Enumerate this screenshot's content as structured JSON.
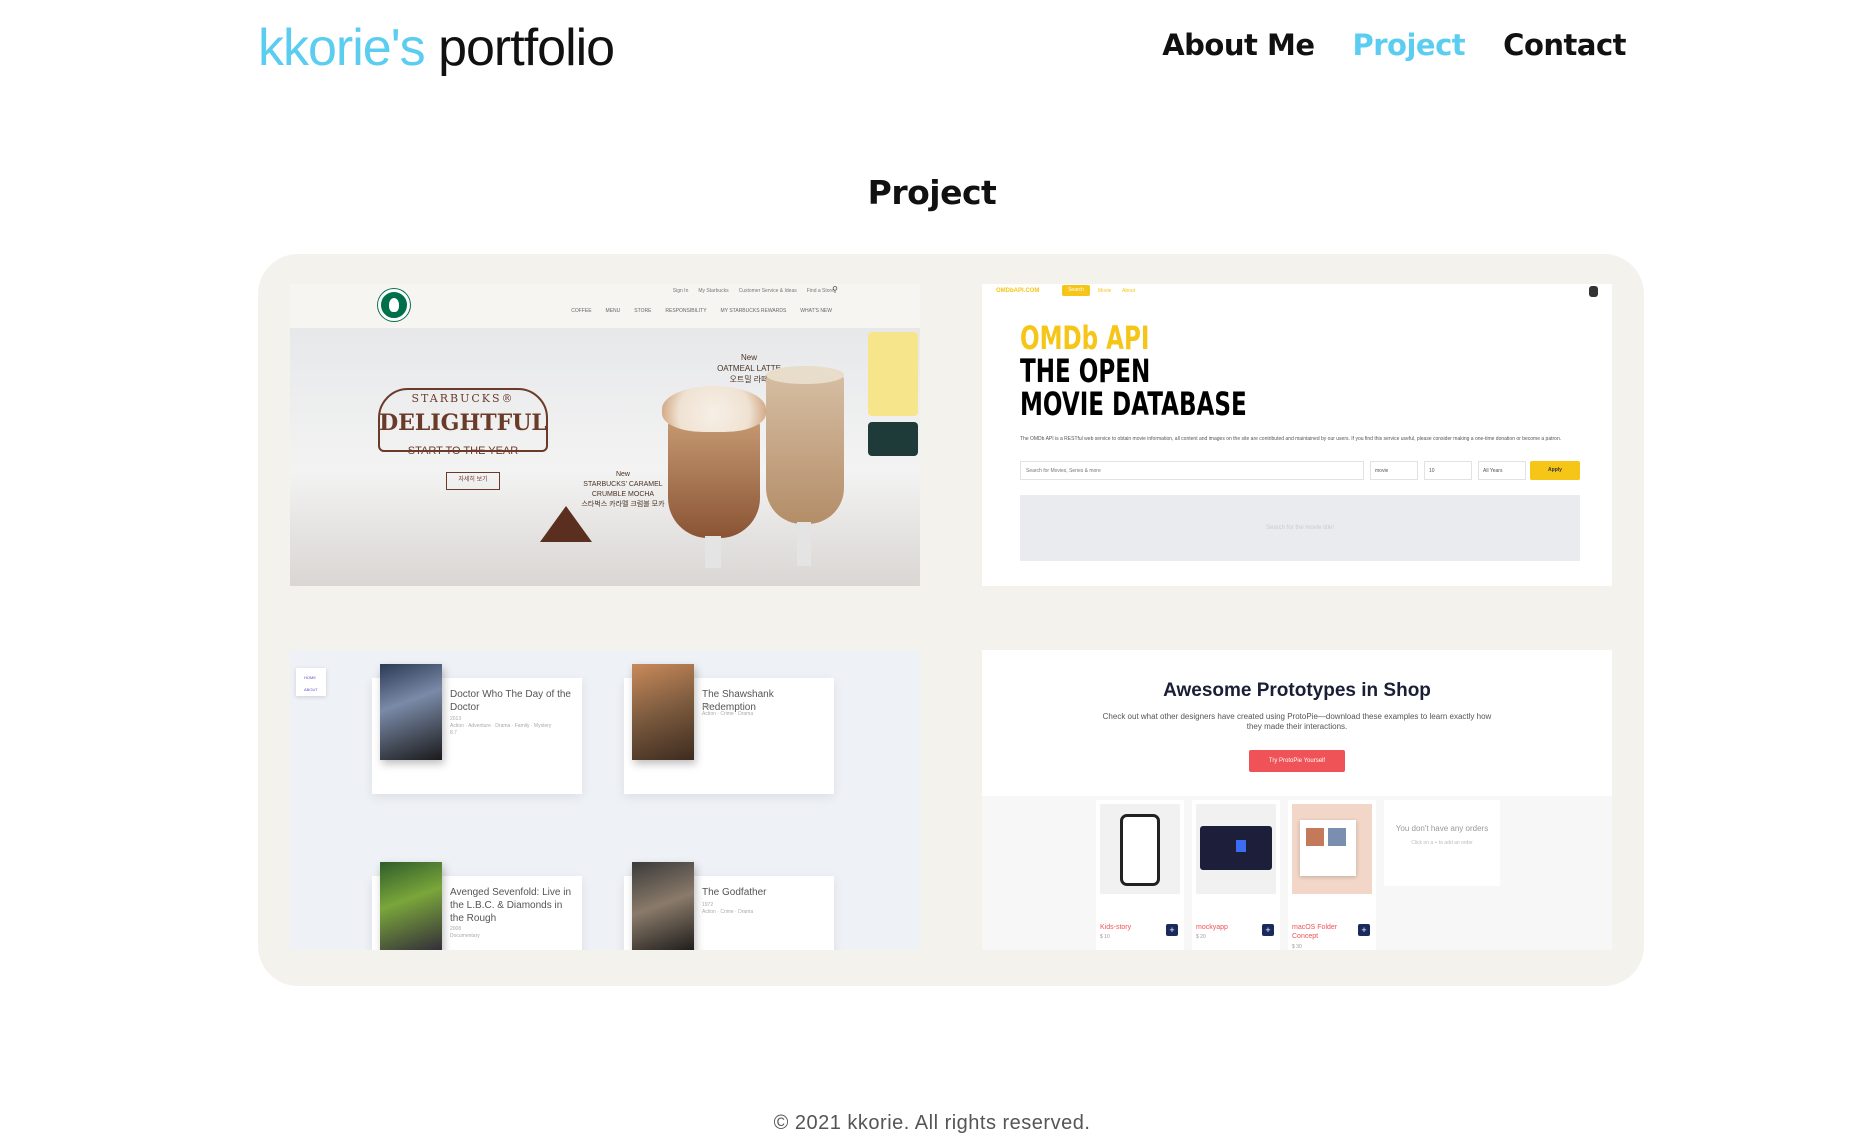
{
  "header": {
    "logo_accent": "kkorie's",
    "logo_rest": "portfolio",
    "nav": [
      "About Me",
      "Project",
      "Contact"
    ],
    "active_nav": "Project"
  },
  "section_title": "Project",
  "projects": {
    "starbucks": {
      "util_links": [
        "Sign In",
        "My Starbucks",
        "Customer Service & Ideas",
        "Find a Store"
      ],
      "menu": [
        "COFFEE",
        "MENU",
        "STORE",
        "RESPONSIBILITY",
        "MY STARBUCKS REWARDS",
        "WHAT'S NEW"
      ],
      "brand": "STARBUCKS®",
      "headline": "DELIGHTFUL",
      "subline": "START TO THE YEAR",
      "button": "자세히 보기",
      "label_latte": "New\nOATMEAL LATTE\n오트밀 라떼",
      "label_mocha": "New\nSTARBUCKS' CARAMEL\nCRUMBLE MOCHA\n스타벅스 카라멜 크럼블 모카"
    },
    "omdb": {
      "brand": "OMDbAPI.COM",
      "nav": [
        "Search",
        "Movie",
        "About"
      ],
      "title_1": "OMDb API",
      "title_2": "THE OPEN",
      "title_3": "MOVIE DATABASE",
      "description": "The OMDb API is a RESTful web service to obtain movie information, all content and images on the site are contributed and maintained by our users. If you find this service useful, please consider making a one-time donation or become a patron.",
      "search_placeholder": "Search for Movies, Series & more",
      "select_type": "movie",
      "select_count": "10",
      "select_year": "All Years",
      "apply": "Apply",
      "result_placeholder": "Search for the movie title!"
    },
    "movies": {
      "side_links": [
        "HOME",
        "ABOUT"
      ],
      "items": [
        {
          "title": "Doctor Who The Day of the Doctor",
          "meta": "2013\nAction · Adventure · Drama · Family · Mystery\n8.7"
        },
        {
          "title": "The Shawshank Redemption",
          "meta": "1994\nAction · Crime · Drama"
        },
        {
          "title": "Avenged Sevenfold: Live in the L.B.C. & Diamonds in the Rough",
          "meta": "2008\nDocumentary"
        },
        {
          "title": "The Godfather",
          "meta": "1972\nAction · Crime · Drama"
        }
      ]
    },
    "protopie": {
      "title": "Awesome Prototypes in Shop",
      "subtitle": "Check out what other designers have created using ProtoPie—download these examples to learn exactly how they made their interactions.",
      "button": "Try ProtoPie Yourself",
      "items": [
        {
          "name": "Kids-story",
          "price": "$ 10"
        },
        {
          "name": "mockyapp",
          "price": "$ 20"
        },
        {
          "name": "macOS Folder Concept",
          "price": "$ 30"
        }
      ],
      "empty_title": "You don't have any orders",
      "empty_sub": "Click on a + to add an order"
    }
  },
  "footer": "© 2021 kkorie. All rights reserved.",
  "colors": {
    "accent": "#5bcdf0",
    "panel": "#f4f2ed",
    "omdb_yellow": "#f5c518",
    "protopie_red": "#ef5358"
  }
}
